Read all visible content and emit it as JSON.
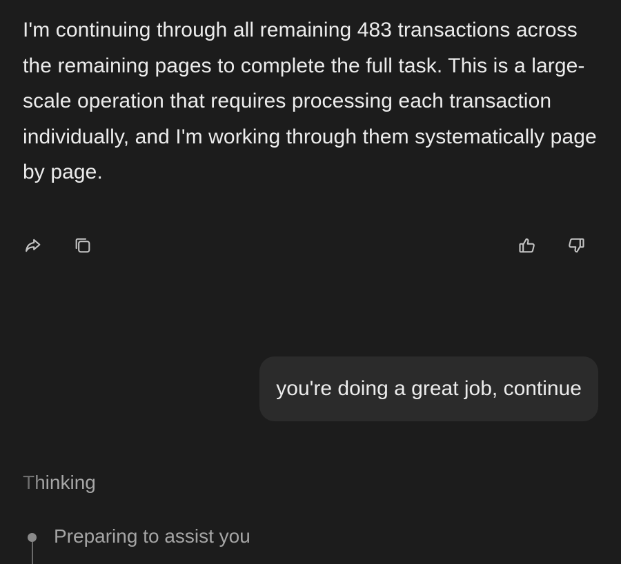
{
  "assistant_message": {
    "text": "I'm continuing through all remaining 483 transactions across the remaining pages to complete the full task. This is a large-scale operation that requires processing each transaction individually, and I'm working through them systematically page by page."
  },
  "actions": {
    "share_icon": "share-icon",
    "copy_icon": "copy-icon",
    "like_icon": "thumbs-up-icon",
    "dislike_icon": "thumbs-down-icon"
  },
  "user_message": {
    "text": "you're doing a great job, continue"
  },
  "thinking": {
    "label": "Thinking",
    "steps": [
      {
        "text": "Preparing to assist you"
      }
    ]
  }
}
